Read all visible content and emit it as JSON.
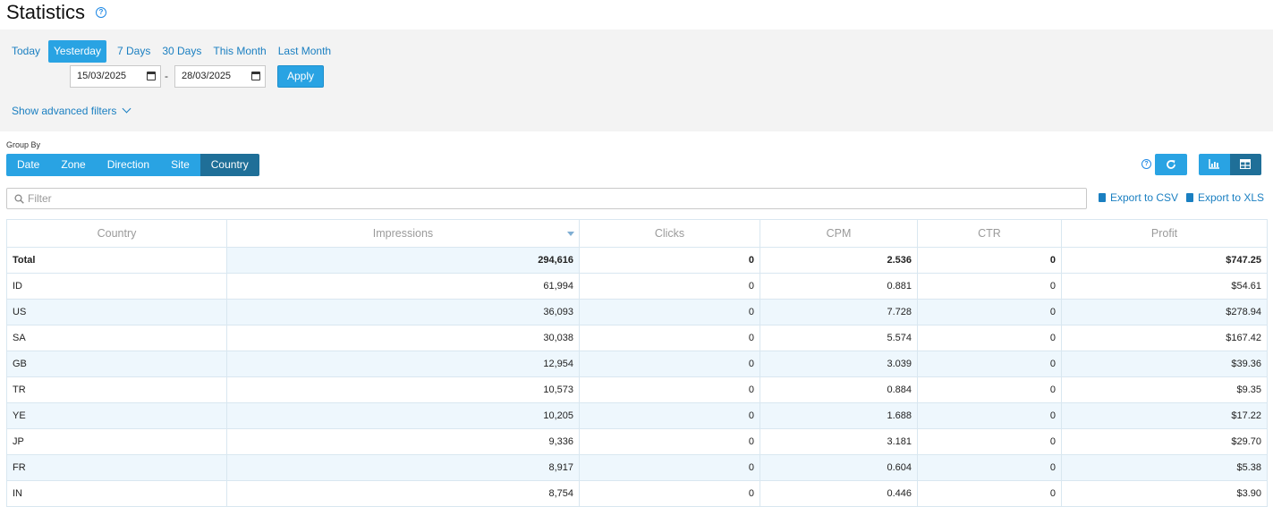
{
  "header": {
    "title": "Statistics",
    "help_glyph": "?"
  },
  "date_filter": {
    "ranges": [
      {
        "label": "Today",
        "active": false
      },
      {
        "label": "Yesterday",
        "active": true
      },
      {
        "label": "7 Days",
        "active": false
      },
      {
        "label": "30 Days",
        "active": false
      },
      {
        "label": "This Month",
        "active": false
      },
      {
        "label": "Last Month",
        "active": false
      }
    ],
    "start_date": "15/03/2025",
    "separator": "-",
    "end_date": "28/03/2025",
    "apply_label": "Apply",
    "advanced_filters_label": "Show advanced filters"
  },
  "group_by": {
    "label": "Group By",
    "options": [
      {
        "label": "Date",
        "active": false
      },
      {
        "label": "Zone",
        "active": false
      },
      {
        "label": "Direction",
        "active": false
      },
      {
        "label": "Site",
        "active": false
      },
      {
        "label": "Country",
        "active": true
      }
    ]
  },
  "toolbar": {
    "help_glyph": "?",
    "refresh_icon": "refresh-icon",
    "views": [
      {
        "icon": "bar-chart-icon",
        "active": false
      },
      {
        "icon": "table-grid-icon",
        "active": true
      }
    ]
  },
  "search": {
    "placeholder": "Filter",
    "value": ""
  },
  "exports": {
    "csv_label": "Export to CSV",
    "xls_label": "Export to XLS"
  },
  "table": {
    "columns": [
      "Country",
      "Impressions",
      "Clicks",
      "CPM",
      "CTR",
      "Profit"
    ],
    "sorted_column": "Impressions",
    "sort_direction": "desc",
    "total": {
      "country": "Total",
      "impressions": "294,616",
      "clicks": "0",
      "cpm": "2.536",
      "ctr": "0",
      "profit": "$747.25"
    },
    "rows": [
      {
        "country": "ID",
        "impressions": "61,994",
        "clicks": "0",
        "cpm": "0.881",
        "ctr": "0",
        "profit": "$54.61"
      },
      {
        "country": "US",
        "impressions": "36,093",
        "clicks": "0",
        "cpm": "7.728",
        "ctr": "0",
        "profit": "$278.94"
      },
      {
        "country": "SA",
        "impressions": "30,038",
        "clicks": "0",
        "cpm": "5.574",
        "ctr": "0",
        "profit": "$167.42"
      },
      {
        "country": "GB",
        "impressions": "12,954",
        "clicks": "0",
        "cpm": "3.039",
        "ctr": "0",
        "profit": "$39.36"
      },
      {
        "country": "TR",
        "impressions": "10,573",
        "clicks": "0",
        "cpm": "0.884",
        "ctr": "0",
        "profit": "$9.35"
      },
      {
        "country": "YE",
        "impressions": "10,205",
        "clicks": "0",
        "cpm": "1.688",
        "ctr": "0",
        "profit": "$17.22"
      },
      {
        "country": "JP",
        "impressions": "9,336",
        "clicks": "0",
        "cpm": "3.181",
        "ctr": "0",
        "profit": "$29.70"
      },
      {
        "country": "FR",
        "impressions": "8,917",
        "clicks": "0",
        "cpm": "0.604",
        "ctr": "0",
        "profit": "$5.38"
      },
      {
        "country": "IN",
        "impressions": "8,754",
        "clicks": "0",
        "cpm": "0.446",
        "ctr": "0",
        "profit": "$3.90"
      }
    ]
  },
  "colors": {
    "accent": "#29a3e3",
    "accent_active": "#1f6f98",
    "link": "#1a7fc1",
    "row_shade": "#eef7fd",
    "panel_bg": "#f3f3f3"
  }
}
